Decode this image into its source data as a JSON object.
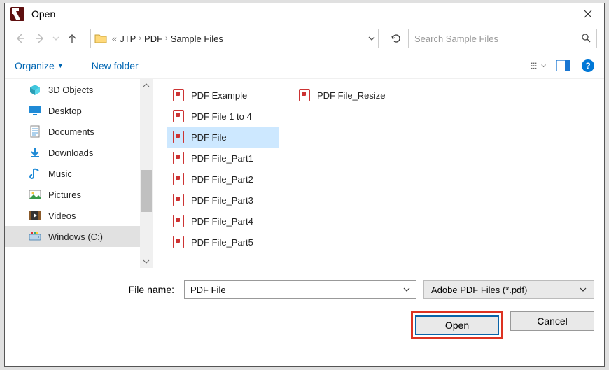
{
  "title": "Open",
  "breadcrumb": {
    "prefix": "«",
    "p1": "JTP",
    "p2": "PDF",
    "p3": "Sample Files"
  },
  "search_placeholder": "Search Sample Files",
  "toolbar": {
    "organize": "Organize",
    "newfolder": "New folder"
  },
  "sidebar": {
    "items": [
      {
        "label": "3D Objects",
        "icon": "3d"
      },
      {
        "label": "Desktop",
        "icon": "desktop"
      },
      {
        "label": "Documents",
        "icon": "doc"
      },
      {
        "label": "Downloads",
        "icon": "down"
      },
      {
        "label": "Music",
        "icon": "music"
      },
      {
        "label": "Pictures",
        "icon": "pic"
      },
      {
        "label": "Videos",
        "icon": "video"
      },
      {
        "label": "Windows (C:)",
        "icon": "drive"
      }
    ]
  },
  "files_col1": [
    "PDF Example",
    "PDF File 1 to 4",
    "PDF File",
    "PDF File_Part1",
    "PDF File_Part2",
    "PDF File_Part3",
    "PDF File_Part4",
    "PDF File_Part5"
  ],
  "files_col2": [
    "PDF File_Resize"
  ],
  "selected_index": 2,
  "footer": {
    "filename_label": "File name:",
    "filename_value": "PDF File",
    "filter": "Adobe PDF Files (*.pdf)",
    "open": "Open",
    "cancel": "Cancel"
  }
}
